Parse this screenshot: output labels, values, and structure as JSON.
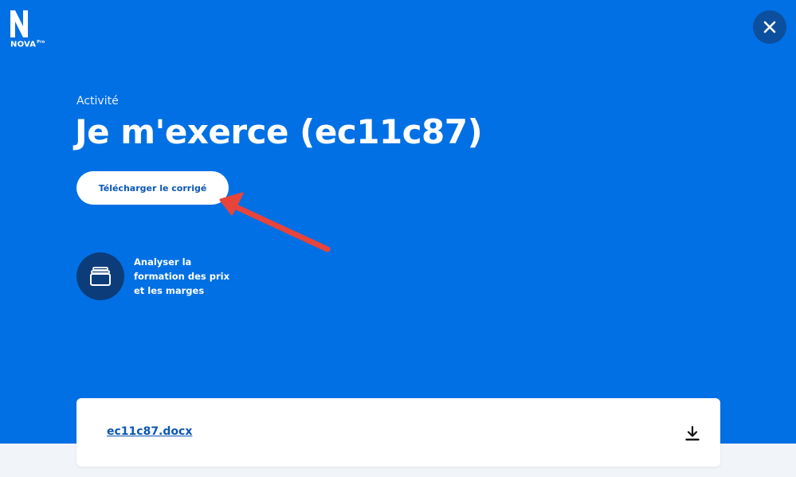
{
  "brand": {
    "name": "NOVA",
    "tag": "Pro"
  },
  "header": {
    "eyebrow": "Activité",
    "title": "Je m'exerce (ec11c87)"
  },
  "actions": {
    "download_answer_label": "Télécharger le corrigé"
  },
  "activity": {
    "label": "Analyser la formation des prix et les marges",
    "icon": "cards-stack-icon"
  },
  "file": {
    "name": "ec11c87.docx",
    "action_icon": "download-icon"
  },
  "colors": {
    "background": "#0170e4",
    "close_button_bg": "#0c4f9e",
    "activity_icon_bg": "#0c3d7a",
    "button_text": "#0c57b5",
    "annotation_arrow": "#e8443b"
  }
}
